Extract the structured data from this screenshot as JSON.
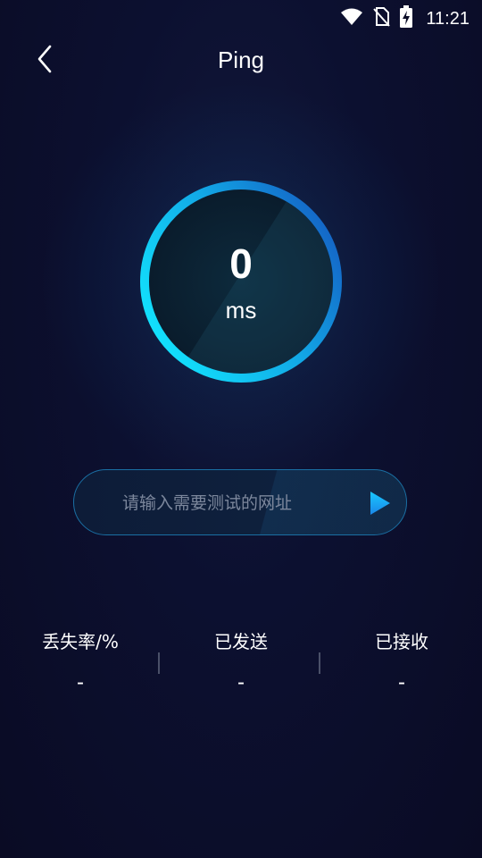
{
  "status_bar": {
    "time": "11:21",
    "icons": [
      "wifi-icon",
      "no-sim-icon",
      "battery-charging-icon"
    ]
  },
  "header": {
    "title": "Ping",
    "back_icon": "chevron-left-icon"
  },
  "gauge": {
    "value": "0",
    "unit": "ms"
  },
  "url_input": {
    "value": "",
    "placeholder": "请输入需要测试的网址"
  },
  "go_button_icon": "play-icon",
  "stats": {
    "loss_rate": {
      "label": "丢失率/%",
      "value": "-"
    },
    "sent": {
      "label": "已发送",
      "value": "-"
    },
    "received": {
      "label": "已接收",
      "value": "-"
    }
  },
  "colors": {
    "background": "#0a0b24",
    "ring_start": "#12e0ff",
    "ring_end": "#1466c8",
    "accent": "#1aa8f0"
  }
}
